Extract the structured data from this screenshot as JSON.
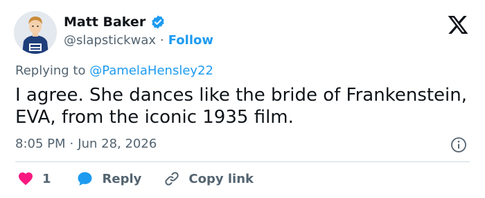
{
  "author": {
    "name": "Matt Baker",
    "handle": "@slapstickwax",
    "separator": "·",
    "follow_label": "Follow",
    "verified": true
  },
  "replying": {
    "prefix": "Replying to",
    "mention": "@PamelaHensley22"
  },
  "tweet": {
    "text": "I agree. She dances like the bride of Frankenstein, EVA, from the iconic 1935 film."
  },
  "meta": {
    "time": "8:05 PM",
    "separator": "·",
    "date": "Jun 28, 2026"
  },
  "actions": {
    "like_count": "1",
    "reply_label": "Reply",
    "copy_label": "Copy link"
  },
  "colors": {
    "accent": "#1d9bf0",
    "like": "#f91880",
    "text": "#0f1419",
    "muted": "#536471",
    "divider": "#cfd9de"
  },
  "icons": {
    "verified": "verified-badge-icon",
    "brand": "x-logo-icon",
    "info": "info-icon",
    "like": "heart-icon",
    "reply": "speech-bubble-icon",
    "copy": "link-icon"
  }
}
